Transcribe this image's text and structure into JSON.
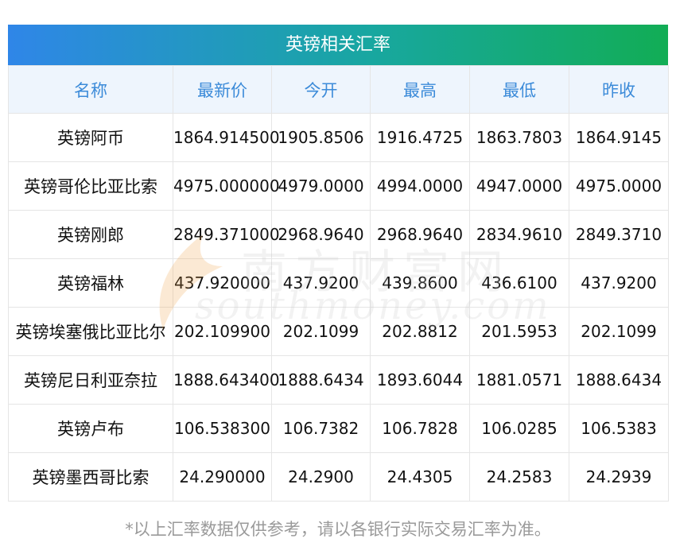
{
  "title": "英镑相关汇率",
  "columns": [
    "名称",
    "最新价",
    "今开",
    "最高",
    "最低",
    "昨收"
  ],
  "rows": [
    [
      "英镑阿币",
      "1864.914500",
      "1905.8506",
      "1916.4725",
      "1863.7803",
      "1864.9145"
    ],
    [
      "英镑哥伦比亚比索",
      "4975.000000",
      "4979.0000",
      "4994.0000",
      "4947.0000",
      "4975.0000"
    ],
    [
      "英镑刚郎",
      "2849.371000",
      "2968.9640",
      "2968.9640",
      "2834.9610",
      "2849.3710"
    ],
    [
      "英镑福林",
      "437.920000",
      "437.9200",
      "439.8600",
      "436.6100",
      "437.9200"
    ],
    [
      "英镑埃塞俄比亚比尔",
      "202.109900",
      "202.1099",
      "202.8812",
      "201.5953",
      "202.1099"
    ],
    [
      "英镑尼日利亚奈拉",
      "1888.643400",
      "1888.6434",
      "1893.6044",
      "1881.0571",
      "1888.6434"
    ],
    [
      "英镑卢布",
      "106.538300",
      "106.7382",
      "106.7828",
      "106.0285",
      "106.5383"
    ],
    [
      "英镑墨西哥比索",
      "24.290000",
      "24.2900",
      "24.4305",
      "24.2583",
      "24.2939"
    ]
  ],
  "footnote": "*以上汇率数据仅供参考，请以各银行实际交易汇率为准。",
  "watermark": {
    "cn": "南方财富网",
    "en": "southmoney.com"
  },
  "colors": {
    "title_gradient_start": "#2f86e8",
    "title_gradient_end": "#12ad55",
    "header_text": "#3c8bd9",
    "header_bg": "#eef5fd",
    "footnote_text": "#9a9a9a"
  }
}
